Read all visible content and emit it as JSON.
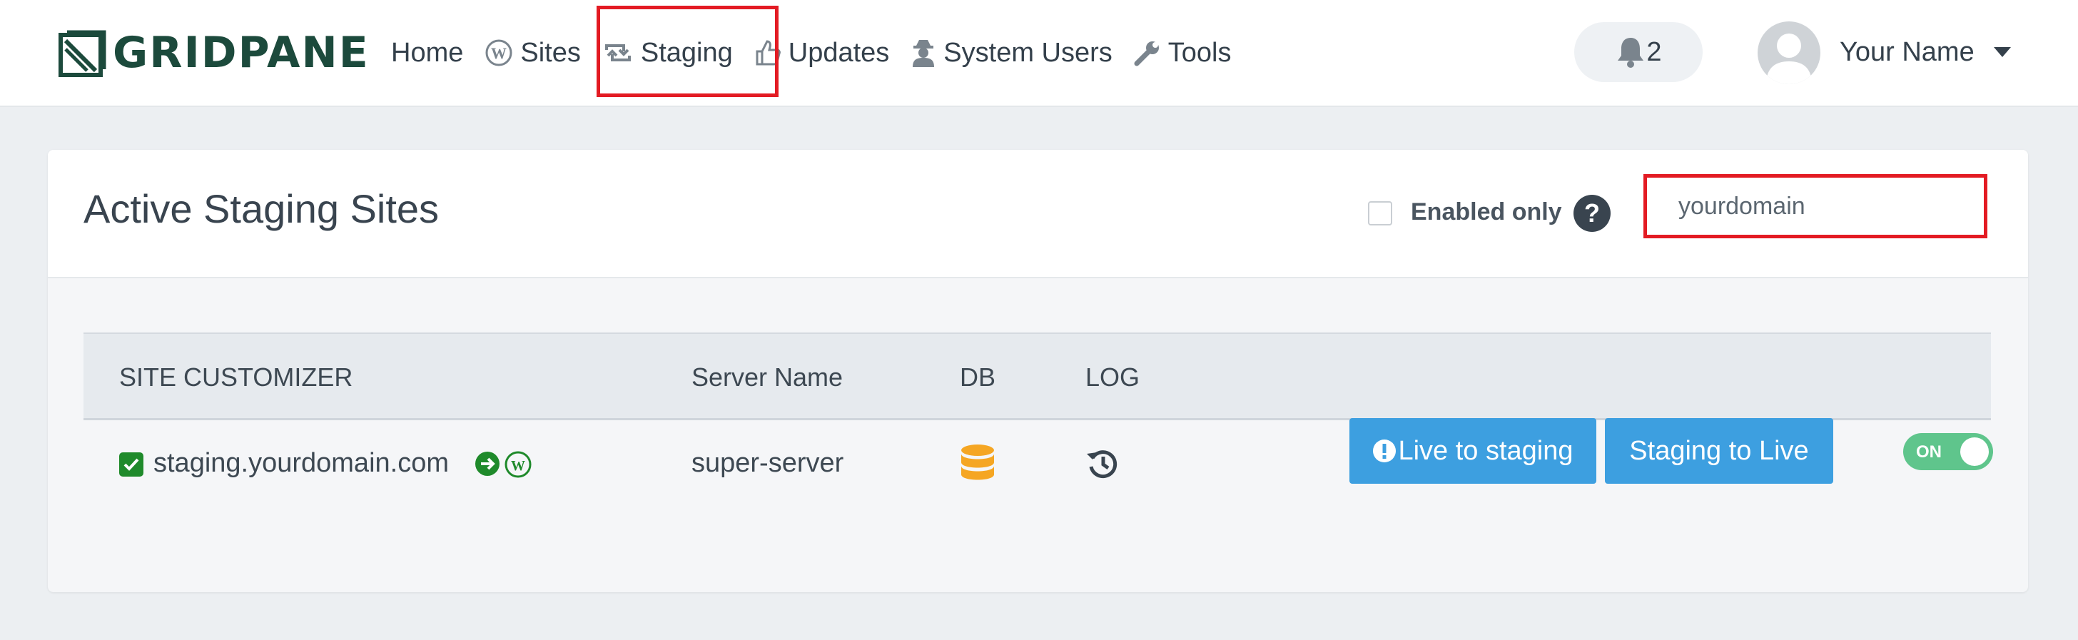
{
  "app": {
    "logo_text": "GRIDPANE"
  },
  "nav": {
    "items": [
      {
        "label": "Home",
        "icon": "none"
      },
      {
        "label": "Sites",
        "icon": "wordpress-icon"
      },
      {
        "label": "Staging",
        "icon": "retweet-icon"
      },
      {
        "label": "Updates",
        "icon": "thumbs-up-icon"
      },
      {
        "label": "System Users",
        "icon": "user-secret-icon"
      },
      {
        "label": "Tools",
        "icon": "wrench-icon"
      }
    ],
    "notifications": {
      "count": "2",
      "icon": "bell-icon"
    },
    "user": {
      "name": "Your Name"
    }
  },
  "card": {
    "title": "Active Staging Sites",
    "filter": {
      "enabled_only_label": "Enabled only",
      "checked": false
    },
    "help_icon": "?",
    "search": {
      "value": "yourdomain",
      "placeholder": ""
    }
  },
  "table": {
    "headers": {
      "site": "SITE CUSTOMIZER",
      "server": "Server Name",
      "db": "DB",
      "log": "LOG"
    },
    "rows": [
      {
        "site": "staging.yourdomain.com",
        "server": "super-server",
        "actions": {
          "live_to_staging": "Live to staging",
          "staging_to_live": "Staging to Live"
        },
        "toggle": "ON"
      }
    ]
  },
  "colors": {
    "accent_blue": "#3d9fe0",
    "toggle_green": "#5fc58c",
    "highlight_red": "#e31b23",
    "db_orange": "#f5a623",
    "check_green": "#1f8a2b"
  }
}
